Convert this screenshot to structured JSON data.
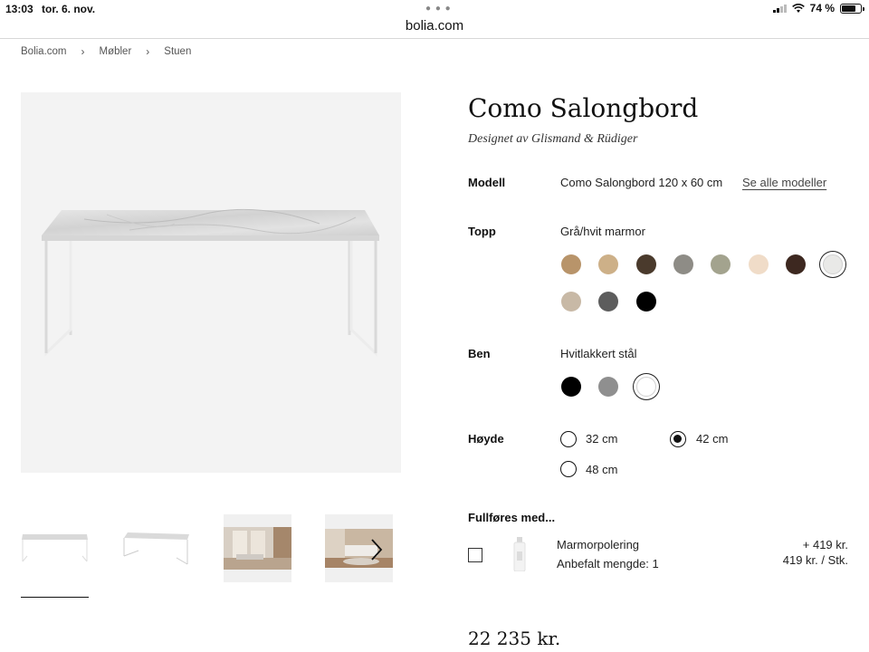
{
  "status_bar": {
    "time": "13:03",
    "date": "tor. 6. nov.",
    "battery": "74 %",
    "battery_level": 0.74
  },
  "browser": {
    "url": "bolia.com",
    "more_icon": "ellipsis-icon"
  },
  "breadcrumb": [
    "Bolia.com",
    "Møbler",
    "Stuen"
  ],
  "product": {
    "title": "Como Salongbord",
    "designer": "Designet av Glismand & Rüdiger",
    "price": "22 235 kr."
  },
  "options": {
    "model": {
      "label": "Modell",
      "value": "Como Salongbord 120 x 60 cm",
      "link": "Se alle modeller"
    },
    "top": {
      "label": "Topp",
      "value": "Grå/hvit marmor",
      "swatches": [
        "#b8946a",
        "#cdb088",
        "#4a3a2c",
        "#8e8c86",
        "#a3a38e",
        "#f0dcc8",
        "#3d2820",
        "#e9e9e7",
        "#c8b9a6",
        "#5d5d5d",
        "#000000"
      ],
      "selected_index": 7
    },
    "legs": {
      "label": "Ben",
      "value": "Hvitlakkert stål",
      "swatches": [
        "#000000",
        "#8f8f8f",
        "#ffffff"
      ],
      "selected_index": 2
    },
    "height": {
      "label": "Høyde",
      "choices": [
        "32 cm",
        "42 cm",
        "48 cm"
      ],
      "selected": "42 cm"
    }
  },
  "addons": {
    "title": "Fullføres med...",
    "item": {
      "name": "Marmorpolering",
      "quantity": "Anbefalt mengde: 1",
      "price": "+ 419 kr.",
      "unit_price": "419 kr. / Stk.",
      "checked": false
    }
  },
  "gallery": {
    "thumbnails": 4,
    "active_index": 0,
    "next_icon": "chevron-right-icon"
  },
  "colors": {
    "text": "#111111",
    "muted": "#555555",
    "image_bg": "#f3f3f3"
  }
}
